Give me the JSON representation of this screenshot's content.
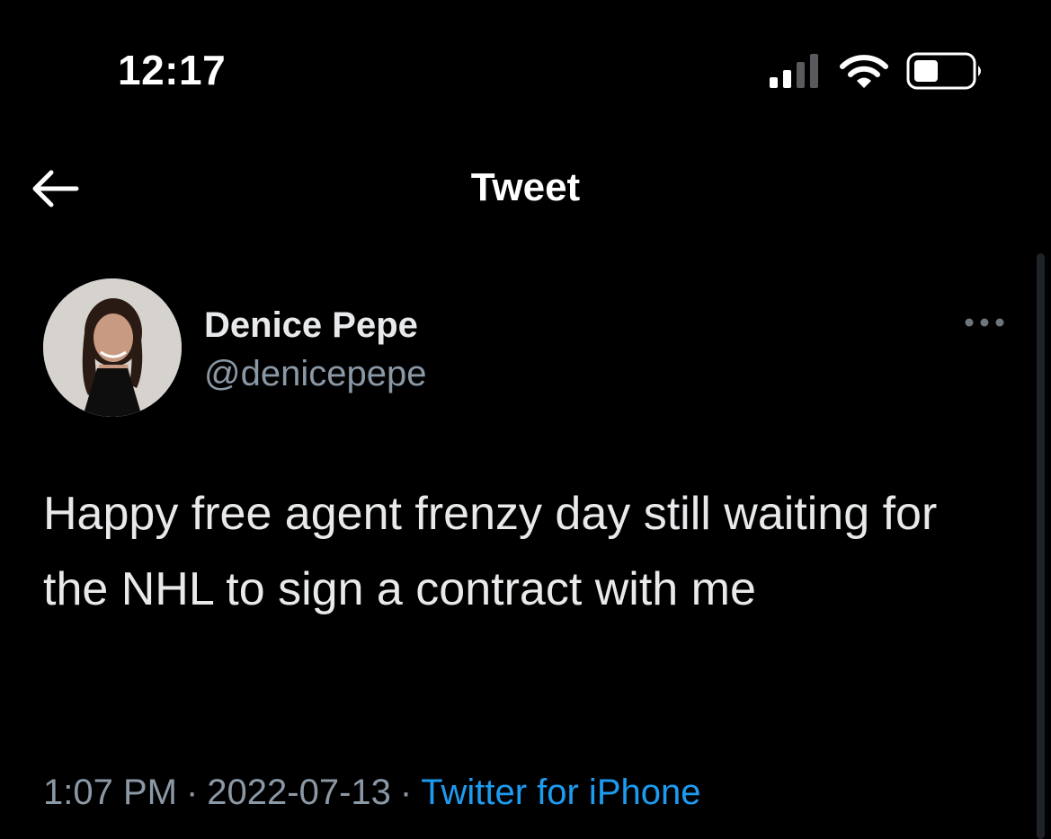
{
  "status_bar": {
    "time": "12:17",
    "icons": [
      "cellular-signal-icon",
      "wifi-icon",
      "battery-icon"
    ]
  },
  "nav": {
    "back_icon": "arrow-left-icon",
    "title": "Tweet"
  },
  "tweet": {
    "author_name": "Denice Pepe",
    "author_handle": "@denicepepe",
    "more_icon": "more-horizontal-icon",
    "text": "Happy free agent frenzy day still waiting for the NHL to sign a contract with me",
    "time": "1:07 PM",
    "date": "2022-07-13",
    "separator": "·",
    "source": "Twitter for iPhone"
  },
  "colors": {
    "background": "#000000",
    "text_primary": "#e7e9ea",
    "text_secondary": "#8b98a5",
    "link": "#1d9bf0"
  }
}
